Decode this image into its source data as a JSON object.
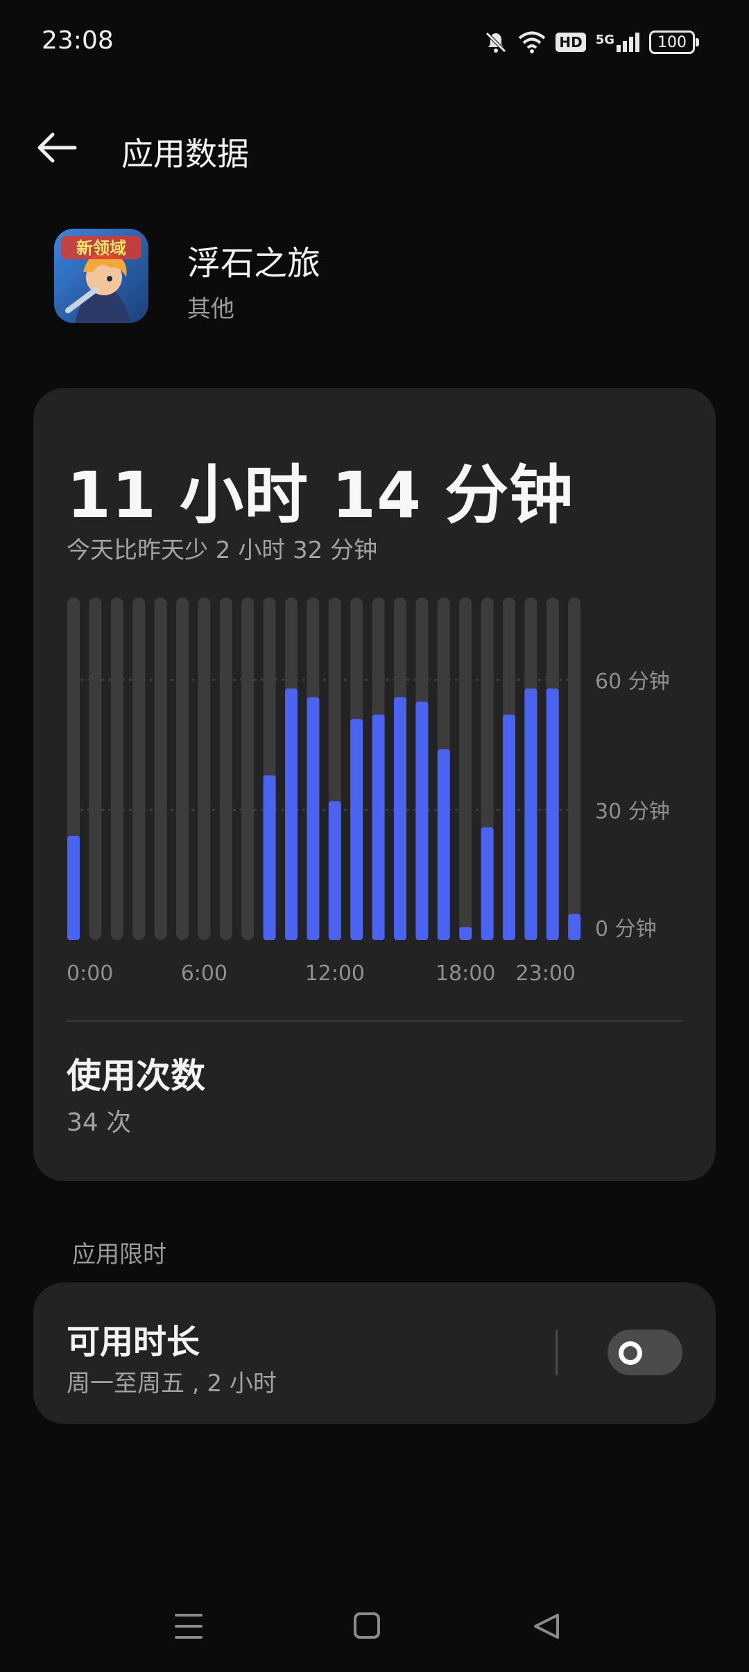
{
  "status_bar": {
    "time": "23:08",
    "battery": "100",
    "hd_label": "HD",
    "network_label": "5G",
    "icons": [
      "bell-off-icon",
      "wifi-icon",
      "hd-icon",
      "signal-5g-icon",
      "battery-icon"
    ]
  },
  "header": {
    "title": "应用数据",
    "back_icon": "arrow-left-icon"
  },
  "app": {
    "name": "浮石之旅",
    "category": "其他",
    "icon_text": "新领域"
  },
  "usage": {
    "total": "11 小时 14 分钟",
    "compare": "今天比昨天少 2 小时 32 分钟"
  },
  "chart_data": {
    "type": "bar",
    "categories": [
      "0:00",
      "1:00",
      "2:00",
      "3:00",
      "4:00",
      "5:00",
      "6:00",
      "7:00",
      "8:00",
      "9:00",
      "10:00",
      "11:00",
      "12:00",
      "13:00",
      "14:00",
      "15:00",
      "16:00",
      "17:00",
      "18:00",
      "19:00",
      "20:00",
      "21:00",
      "22:00",
      "23:00"
    ],
    "values": [
      24,
      0,
      0,
      0,
      0,
      0,
      0,
      0,
      0,
      38,
      58,
      56,
      32,
      51,
      52,
      56,
      55,
      44,
      3,
      26,
      52,
      58,
      58,
      6
    ],
    "x_tick_labels": [
      "0:00",
      "6:00",
      "12:00",
      "18:00",
      "23:00"
    ],
    "y_tick_labels": [
      "60 分钟",
      "30 分钟",
      "0 分钟"
    ],
    "y_ticks": [
      60,
      30,
      0
    ],
    "ylim": [
      0,
      79
    ],
    "bar_color": "#4a63f0",
    "track_color": "#3c3c3c"
  },
  "launches": {
    "title": "使用次数",
    "value": "34 次"
  },
  "limit": {
    "section_header": "应用限时",
    "title": "可用时长",
    "subtitle": "周一至周五 , 2 小时",
    "enabled": false
  },
  "nav": {
    "icons": [
      "menu-icon",
      "home-icon",
      "back-icon"
    ]
  }
}
